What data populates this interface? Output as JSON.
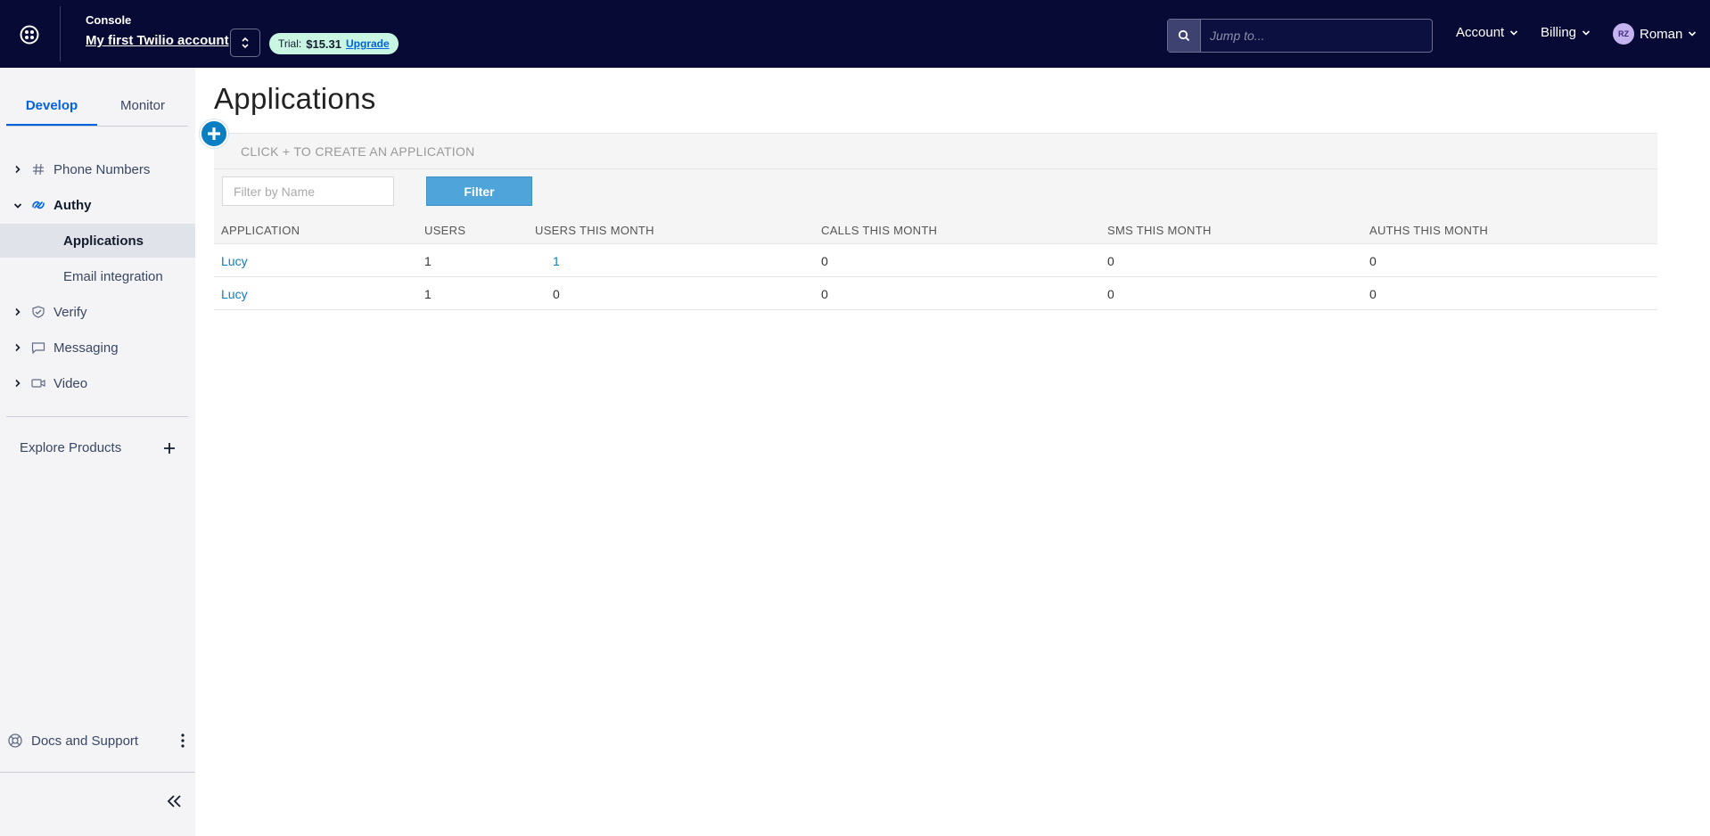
{
  "header": {
    "console_label": "Console",
    "account_name": "My first Twilio account",
    "trial_label": "Trial:",
    "trial_amount": "$15.31",
    "upgrade_label": "Upgrade",
    "search_placeholder": "Jump to...",
    "account_menu": "Account",
    "billing_menu": "Billing",
    "user_initials": "RZ",
    "user_name": "Roman"
  },
  "sidebar": {
    "tabs": [
      {
        "label": "Develop",
        "active": true
      },
      {
        "label": "Monitor",
        "active": false
      }
    ],
    "items": [
      {
        "label": "Phone Numbers",
        "icon": "hash-icon"
      },
      {
        "label": "Authy",
        "icon": "authy-icon"
      },
      {
        "label": "Applications"
      },
      {
        "label": "Email integration"
      },
      {
        "label": "Verify",
        "icon": "verify-icon"
      },
      {
        "label": "Messaging",
        "icon": "chat-icon"
      },
      {
        "label": "Video",
        "icon": "video-icon"
      }
    ],
    "explore_label": "Explore Products",
    "docs_label": "Docs and Support"
  },
  "main": {
    "title": "Applications",
    "create_hint": "CLICK + TO CREATE AN APPLICATION",
    "filter_placeholder": "Filter by Name",
    "filter_button": "Filter",
    "columns": [
      "APPLICATION",
      "USERS",
      "USERS THIS MONTH",
      "CALLS THIS MONTH",
      "SMS THIS MONTH",
      "AUTHS THIS MONTH"
    ],
    "rows": [
      [
        "Lucy",
        "1",
        "1",
        "0",
        "0",
        "0"
      ],
      [
        "Lucy",
        "1",
        "0",
        "0",
        "0",
        "0"
      ]
    ]
  },
  "colors": {
    "topbar": "#060a35",
    "accent": "#0263e0",
    "link": "#0a7ec2",
    "filter_button": "#4fa4da"
  }
}
